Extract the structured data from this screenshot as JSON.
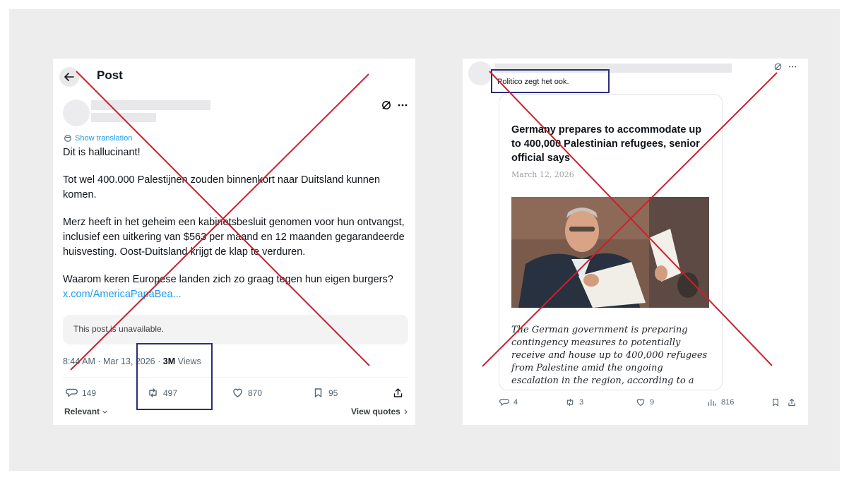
{
  "left_post": {
    "header_title": "Post",
    "show_translation": "Show translation",
    "paragraphs": [
      "Dit is hallucinant!",
      "Tot wel 400.000 Palestijnen zouden binnenkort naar Duitsland kunnen komen.",
      "Merz heeft in het geheim een kabinetsbesluit genomen voor hun ontvangst, inclusief een uitkering van $563 per maand en 12 maanden gegarandeerde huisvesting.  Oost-Duitsland krijgt de klap te verduren.",
      "Waarom keren Europese landen zich zo graag tegen hun eigen burgers?"
    ],
    "link_text": "x.com/AmericaPapaBea...",
    "unavailable_text": "This post is unavailable.",
    "timestamp": "8:44 AM · Mar 13, 2026 · ",
    "views_count": "3M",
    "views_label": " Views",
    "replies": "149",
    "reposts": "497",
    "likes": "870",
    "bookmarks": "95",
    "sort_label": "Relevant",
    "view_quotes": "View quotes"
  },
  "right_post": {
    "text": "Politico zegt het ook.",
    "article_title": "Germany prepares to accommodate up to 400,000 Palestinian refugees, senior official says",
    "article_date": "March 12, 2026",
    "article_excerpt": "The German government is preparing contingency measures to potentially receive and house up to 400,000 refugees from Palestine amid the ongoing escalation in the region, according to a",
    "replies": "4",
    "reposts": "3",
    "likes": "9",
    "views": "816"
  },
  "colors": {
    "cross": "#cc1f2e",
    "highlight_box": "#2b2d7a",
    "link": "#1d9bf0",
    "backdrop": "#ededed"
  }
}
